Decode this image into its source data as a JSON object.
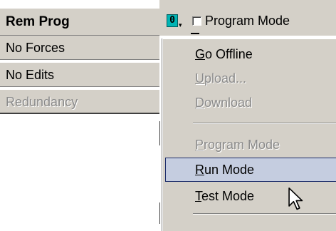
{
  "status": {
    "title": "Rem Prog",
    "rows": [
      "No Forces",
      "No Edits",
      "Redundancy"
    ]
  },
  "mode_control": {
    "icon_glyph": "0",
    "dropdown_glyph": "▾",
    "program_mode_label": "Program Mode",
    "program_mode_checked": false,
    "icon_color": "#00b4b4"
  },
  "menu": {
    "items": [
      {
        "mnemonic": "G",
        "rest": "o Offline",
        "enabled": true
      },
      {
        "mnemonic": "U",
        "rest": "pload...",
        "enabled": false
      },
      {
        "mnemonic": "D",
        "rest": "ownload",
        "enabled": false
      },
      {
        "mnemonic": "P",
        "rest": "rogram Mode",
        "enabled": false
      },
      {
        "mnemonic": "R",
        "rest": "un Mode",
        "enabled": true,
        "highlighted": true
      },
      {
        "mnemonic": "T",
        "rest": "est Mode",
        "enabled": true
      }
    ],
    "highlight_color": "#c5cde0"
  }
}
